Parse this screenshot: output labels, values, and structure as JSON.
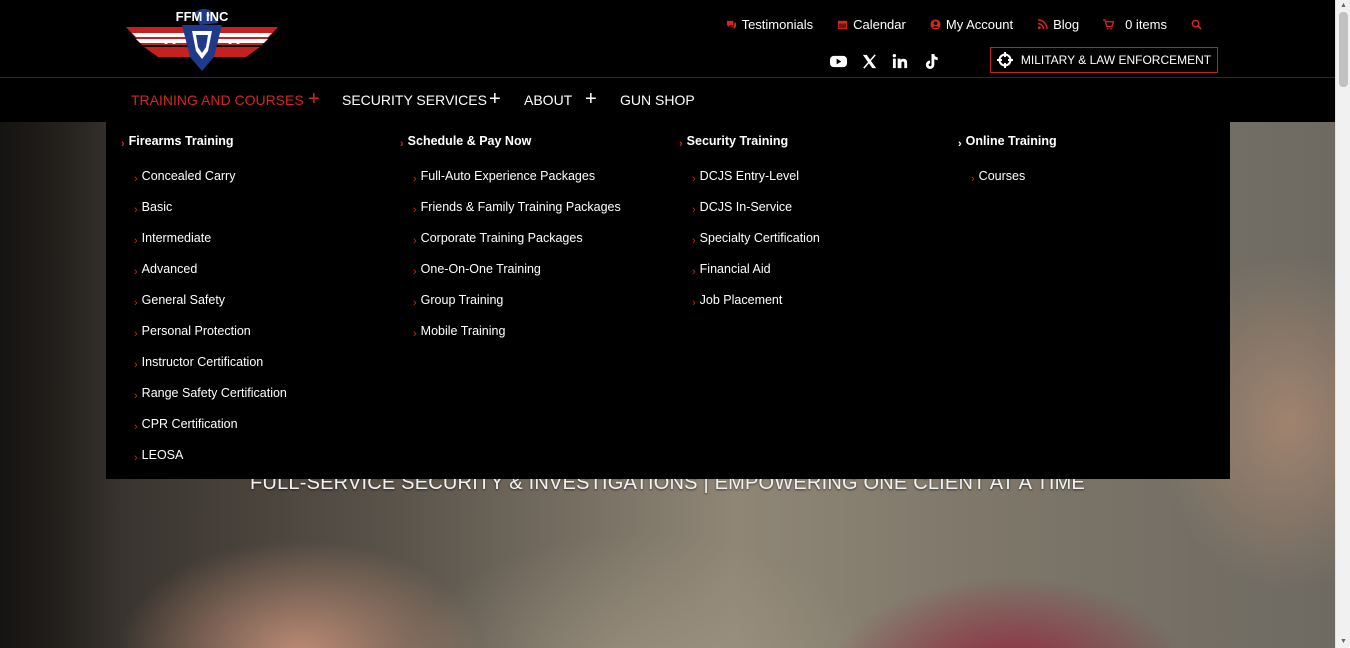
{
  "logo": {
    "text": "FFM INC",
    "icon": "eagle-flag-wings-logo"
  },
  "util_links": [
    {
      "label": "Testimonials",
      "icon": "chat-icon"
    },
    {
      "label": "Calendar",
      "icon": "calendar-icon"
    },
    {
      "label": "My Account",
      "icon": "user-icon"
    },
    {
      "label": "Blog",
      "icon": "rss-icon"
    },
    {
      "label": "0 items",
      "icon": "cart-icon"
    }
  ],
  "socials": [
    "youtube-icon",
    "x-icon",
    "linkedin-icon",
    "tiktok-icon"
  ],
  "military_button": "MILITARY & LAW ENFORCEMENT",
  "nav": [
    {
      "label": "TRAINING AND COURSES",
      "active": true
    },
    {
      "label": "SECURITY SERVICES"
    },
    {
      "label": "ABOUT"
    },
    {
      "label": "GUN SHOP"
    }
  ],
  "mega_menu": [
    {
      "heading": "Firearms Training",
      "items": [
        "Concealed Carry",
        "Basic",
        "Intermediate",
        "Advanced",
        "General Safety",
        "Personal Protection",
        "Instructor Certification",
        "Range Safety Certification",
        "CPR Certification",
        "LEOSA"
      ]
    },
    {
      "heading": "Schedule & Pay Now",
      "items": [
        "Full-Auto Experience Packages",
        "Friends & Family Training Packages",
        "Corporate Training Packages",
        "One-On-One Training",
        "Group Training",
        "Mobile Training"
      ]
    },
    {
      "heading": "Security Training",
      "items": [
        "DCJS Entry-Level",
        "DCJS In-Service",
        "Specialty Certification",
        "Financial Aid",
        "Job Placement"
      ]
    },
    {
      "heading": "Online Training",
      "items": [
        "Courses"
      ]
    }
  ],
  "hero": {
    "tagline": "FULL-SERVICE SECURITY & INVESTIGATIONS | EMPOWERING ONE CLIENT AT A TIME"
  },
  "colors": {
    "accent": "#d7261f",
    "background": "#000000"
  }
}
